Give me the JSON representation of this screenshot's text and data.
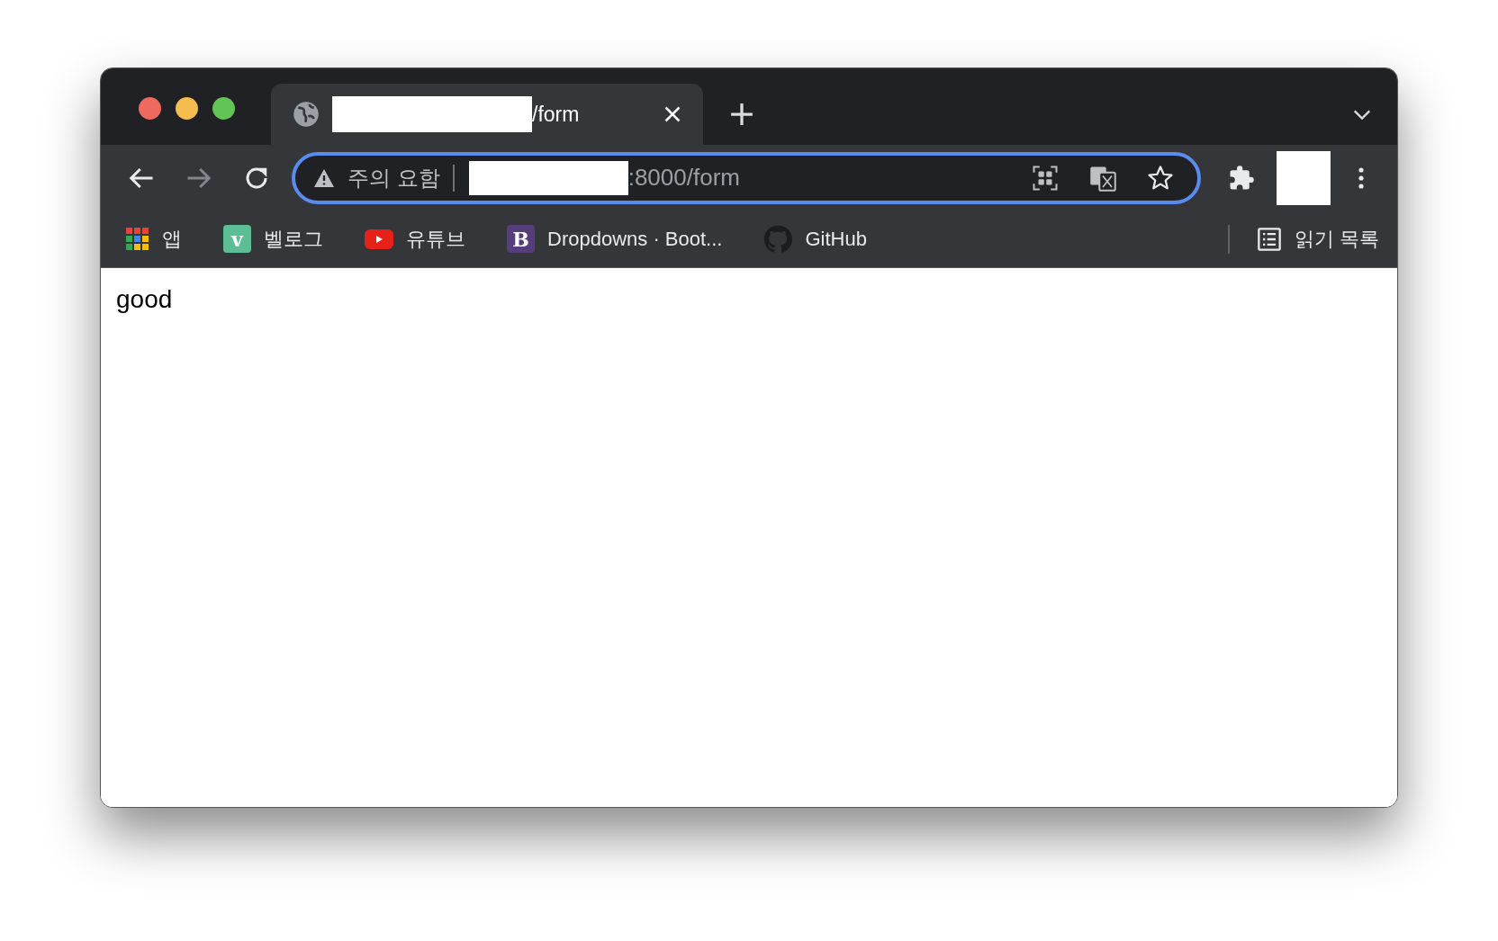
{
  "tabs": [
    {
      "title": "/form",
      "selected": true
    }
  ],
  "toolbar": {
    "back_disabled": false,
    "forward_disabled": true
  },
  "address_bar": {
    "security_label": "주의 요함",
    "url": ":8000/form",
    "focused": true
  },
  "bookmarks": [
    {
      "kind": "apps",
      "label": "앱"
    },
    {
      "kind": "letter",
      "logo_letter": "v",
      "color": "#5dbe96",
      "label": "벨로그"
    },
    {
      "kind": "youtube",
      "label": "유튜브"
    },
    {
      "kind": "letter",
      "logo_letter": "B",
      "color": "#563d7c",
      "label": "Dropdowns · Boot..."
    },
    {
      "kind": "github",
      "label": "GitHub"
    }
  ],
  "reading_list": {
    "label": "읽기 목록"
  },
  "page": {
    "body_text": "good"
  }
}
